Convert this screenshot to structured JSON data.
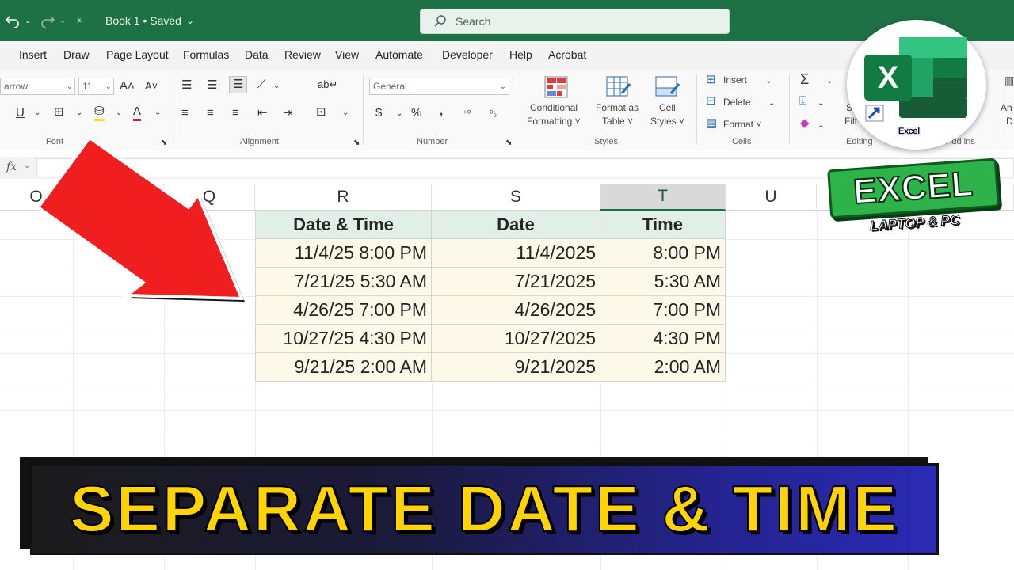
{
  "titlebar": {
    "doc_title": "Book 1 • Saved",
    "search_placeholder": "Search"
  },
  "tabs": [
    "Insert",
    "Draw",
    "Page Layout",
    "Formulas",
    "Data",
    "Review",
    "View",
    "Automate",
    "Developer",
    "Help",
    "Acrobat"
  ],
  "ribbon": {
    "font_name": "arrow",
    "font_size": "11",
    "number_format": "General",
    "group_font": "Font",
    "group_alignment": "Alignment",
    "group_number": "Number",
    "group_styles": "Styles",
    "group_cells": "Cells",
    "group_editing": "Editing",
    "group_addins": "Add ins",
    "conditional_formatting": [
      "Conditional",
      "Formatting ˅"
    ],
    "format_as_table": [
      "Format as",
      "Table ˅"
    ],
    "cell_styles": [
      "Cell",
      "Styles ˅"
    ],
    "insert": "Insert",
    "delete": "Delete",
    "format": "Format ˅",
    "partial_left": [
      "S",
      "Filt"
    ],
    "partial_right": [
      "An",
      "D"
    ]
  },
  "formulabar": {
    "fx": "fx"
  },
  "columns": [
    "O",
    "Q",
    "R",
    "S",
    "T",
    "U"
  ],
  "table": {
    "headers": [
      "Date & Time",
      "Date",
      "Time"
    ],
    "rows": [
      [
        "11/4/25 8:00 PM",
        "11/4/2025",
        "8:00 PM"
      ],
      [
        "7/21/25 5:30 AM",
        "7/21/2025",
        "5:30 AM"
      ],
      [
        "4/26/25 7:00 PM",
        "4/26/2025",
        "7:00 PM"
      ],
      [
        "10/27/25 4:30 PM",
        "10/27/2025",
        "4:30 PM"
      ],
      [
        "9/21/25 2:00 AM",
        "9/21/2025",
        "2:00 AM"
      ]
    ]
  },
  "overlay": {
    "banner": "SEPARATE DATE & TIME",
    "badge": "EXCEL",
    "badge_sub": "LAPTOP & PC",
    "logo_caption": "Excel",
    "logo_letter": "X"
  },
  "colors": {
    "excel_green": "#1e7145",
    "banner_yellow": "#ffd400",
    "arrow_red": "#f01e1e",
    "header_fill": "#e2efe7",
    "data_fill": "#fdf9e8"
  }
}
